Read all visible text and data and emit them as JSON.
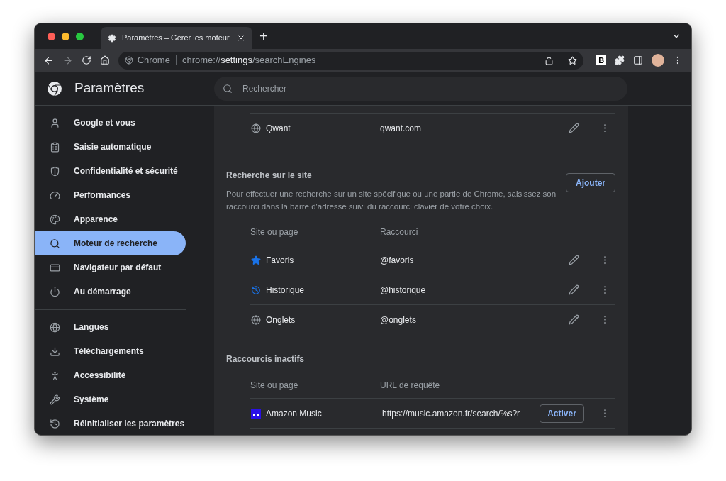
{
  "tab": {
    "title": "Paramètres – Gérer les moteur",
    "new_tab": "+"
  },
  "toolbar": {
    "forward_disabled": true,
    "chip": "Chrome",
    "url": {
      "scheme": "chrome://",
      "host": "settings",
      "path": "/searchEngines"
    },
    "extension_letter": "B"
  },
  "header": {
    "title": "Paramètres",
    "search": {
      "placeholder": "Rechercher"
    }
  },
  "sidebar": {
    "groups": [
      [
        {
          "label": "Google et vous",
          "selected": false
        },
        {
          "label": "Saisie automatique",
          "selected": false
        },
        {
          "label": "Confidentialité et sécurité",
          "selected": false
        },
        {
          "label": "Performances",
          "selected": false
        },
        {
          "label": "Apparence",
          "selected": false
        },
        {
          "label": "Moteur de recherche",
          "selected": true
        },
        {
          "label": "Navigateur par défaut",
          "selected": false
        },
        {
          "label": "Au démarrage",
          "selected": false
        }
      ],
      [
        {
          "label": "Langues",
          "selected": false
        },
        {
          "label": "Téléchargements",
          "selected": false
        },
        {
          "label": "Accessibilité",
          "selected": false
        },
        {
          "label": "Système",
          "selected": false
        },
        {
          "label": "Réinitialiser les paramètres",
          "selected": false
        }
      ]
    ]
  },
  "engines": {
    "rows": [
      {
        "name": "Qwant",
        "shortcut": "qwant.com"
      }
    ]
  },
  "site_search": {
    "title": "Recherche sur le site",
    "add_button": "Ajouter",
    "description": "Pour effectuer une recherche sur un site spécifique ou une partie de Chrome, saisissez son raccourci dans la barre d'adresse suivi du raccourci clavier de votre choix.",
    "columns": [
      "Site ou page",
      "Raccourci"
    ],
    "rows": [
      {
        "name": "Favoris",
        "shortcut": "@favoris"
      },
      {
        "name": "Historique",
        "shortcut": "@historique"
      },
      {
        "name": "Onglets",
        "shortcut": "@onglets"
      }
    ]
  },
  "inactive": {
    "title": "Raccourcis inactifs",
    "columns": [
      "Site ou page",
      "URL de requête"
    ],
    "rows": [
      {
        "name": "Amazon Music",
        "url": "https://music.amazon.fr/search/%s?r",
        "button": "Activer"
      }
    ]
  }
}
